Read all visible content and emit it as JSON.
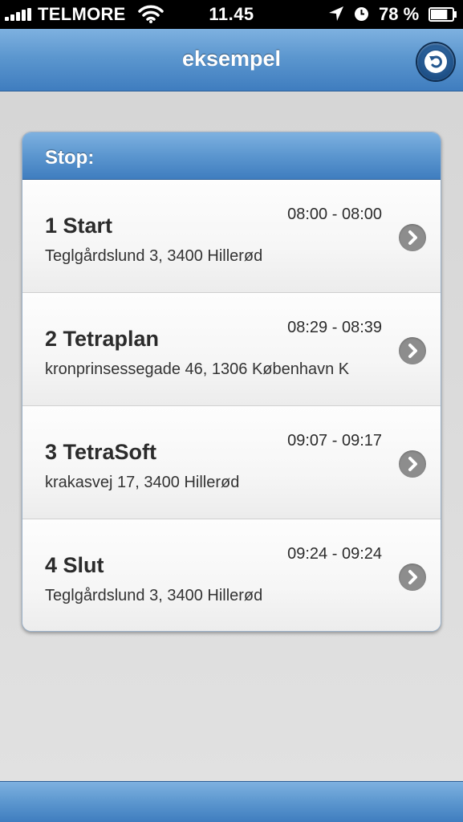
{
  "status_bar": {
    "carrier": "TELMORE",
    "time": "11.45",
    "battery_percent": "78 %",
    "battery_level": 0.78,
    "icons": [
      "signal-icon",
      "wifi-icon",
      "location-arrow-icon",
      "clock-icon",
      "battery-icon"
    ]
  },
  "header": {
    "title": "eksempel",
    "back_icon": "undo-arrow-icon"
  },
  "card": {
    "title": "Stop:",
    "stops": [
      {
        "name": "1 Start",
        "address": "Teglgårdslund 3, 3400 Hillerød",
        "time": "08:00 - 08:00"
      },
      {
        "name": "2 Tetraplan",
        "address": "kronprinsessegade 46, 1306 København K",
        "time": "08:29 - 08:39"
      },
      {
        "name": "3 TetraSoft",
        "address": "krakasvej 17, 3400 Hillerød",
        "time": "09:07 - 09:17"
      },
      {
        "name": "4 Slut",
        "address": "Teglgårdslund 3, 3400 Hillerød",
        "time": "09:24 - 09:24"
      }
    ]
  },
  "colors": {
    "header_blue": "#5c97cf",
    "background": "#dcdcdc",
    "chevron": "#8d8d8d"
  }
}
